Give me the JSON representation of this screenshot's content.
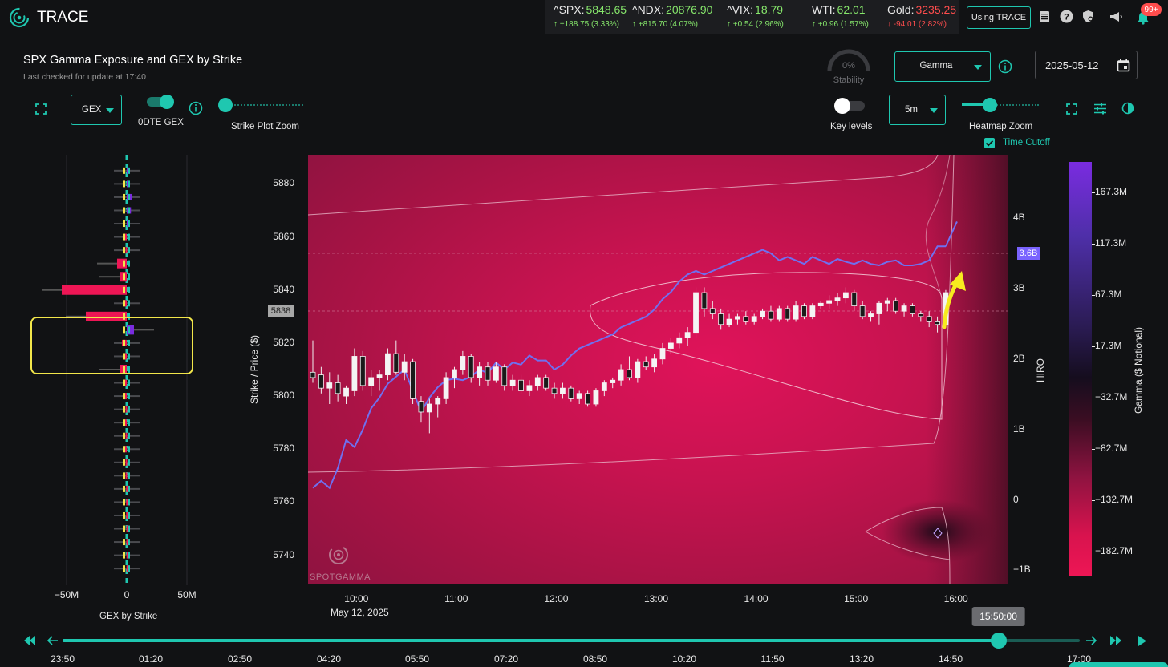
{
  "app": {
    "title": "TRACE"
  },
  "tickers": [
    {
      "label": "^SPX:",
      "value": "5848.65",
      "change": "↑ +188.75 (3.33%)",
      "dir": "up"
    },
    {
      "label": "^NDX:",
      "value": "20876.90",
      "change": "↑ +815.70 (4.07%)",
      "dir": "up"
    },
    {
      "label": "^VIX:",
      "value": "18.79",
      "change": "↑ +0.54 (2.96%)",
      "dir": "up"
    },
    {
      "label": "WTI:",
      "value": "62.01",
      "change": "↑ +0.96 (1.57%)",
      "dir": "up"
    },
    {
      "label": "Gold:",
      "value": "3235.25",
      "change": "↓ -94.01 (2.82%)",
      "dir": "down"
    }
  ],
  "header": {
    "using_trace": "Using TRACE",
    "notification_count": "99+"
  },
  "panel": {
    "title": "SPX Gamma Exposure and GEX by Strike",
    "subtitle": "Last checked for update at 17:40"
  },
  "controls": {
    "gex_select": "GEX",
    "zero_dte_label": "0DTE GEX",
    "strike_zoom_label": "Strike Plot Zoom",
    "stability_value": "0%",
    "stability_label": "Stability",
    "metric_select": "Gamma",
    "date_value": "2025-05-12",
    "key_levels_label": "Key levels",
    "interval_select": "5m",
    "heatmap_zoom_label": "Heatmap Zoom",
    "time_cutoff_label": "Time Cutoff"
  },
  "strike_chart": {
    "xlabel": "GEX by Strike",
    "xticks": [
      "−50M",
      "0",
      "50M"
    ]
  },
  "main_chart": {
    "ylabel": "Strike / Price ($)",
    "yticks": [
      "5880",
      "5860",
      "5840",
      "5820",
      "5800",
      "5780",
      "5760",
      "5740"
    ],
    "price_marker": "5838",
    "xticks": [
      "10:00",
      "11:00",
      "12:00",
      "13:00",
      "14:00",
      "15:00",
      "16:00"
    ],
    "date_label": "May 12, 2025",
    "hiro_label": "HIRO",
    "hiro_ticks": [
      "4B",
      "3B",
      "2B",
      "1B",
      "0",
      "−1B"
    ],
    "hiro_marker": "3.6B",
    "watermark": "SPOTGAMMA"
  },
  "colorbar": {
    "label": "Gamma ($ Notional)",
    "ticks": [
      "167.3M",
      "117.3M",
      "67.3M",
      "17.3M",
      "−32.7M",
      "−82.7M",
      "−132.7M",
      "−182.7M"
    ]
  },
  "timeline": {
    "current_time": "15:50:00",
    "position": 0.92,
    "ticks": [
      "23:50",
      "01:20",
      "02:50",
      "04:20",
      "05:50",
      "07:20",
      "08:50",
      "10:20",
      "11:50",
      "13:20",
      "14:50",
      "17:00"
    ]
  },
  "chart_data": {
    "type": "candlestick",
    "title": "SPX Gamma Exposure and GEX by Strike",
    "xlabel": "",
    "ylabel": "Strike / Price ($)",
    "ylim": [
      5729,
      5891
    ],
    "xlim_time": [
      "09:30",
      "16:30"
    ],
    "hiro_ylim": [
      "−1.2B",
      "4.9B"
    ],
    "candles": [
      {
        "t": "09:30",
        "o": 5809,
        "h": 5821,
        "l": 5805,
        "c": 5807
      },
      {
        "t": "09:35",
        "o": 5808,
        "h": 5811,
        "l": 5801,
        "c": 5803
      },
      {
        "t": "09:40",
        "o": 5803,
        "h": 5809,
        "l": 5797,
        "c": 5805
      },
      {
        "t": "09:45",
        "o": 5805,
        "h": 5808,
        "l": 5798,
        "c": 5801
      },
      {
        "t": "09:50",
        "o": 5800,
        "h": 5804,
        "l": 5797,
        "c": 5803
      },
      {
        "t": "09:55",
        "o": 5802,
        "h": 5818,
        "l": 5800,
        "c": 5815
      },
      {
        "t": "10:00",
        "o": 5815,
        "h": 5817,
        "l": 5802,
        "c": 5804
      },
      {
        "t": "10:05",
        "o": 5804,
        "h": 5810,
        "l": 5800,
        "c": 5807
      },
      {
        "t": "10:10",
        "o": 5807,
        "h": 5810,
        "l": 5802,
        "c": 5808
      },
      {
        "t": "10:15",
        "o": 5808,
        "h": 5818,
        "l": 5806,
        "c": 5816
      },
      {
        "t": "10:20",
        "o": 5816,
        "h": 5821,
        "l": 5808,
        "c": 5809
      },
      {
        "t": "10:25",
        "o": 5809,
        "h": 5816,
        "l": 5806,
        "c": 5813
      },
      {
        "t": "10:30",
        "o": 5813,
        "h": 5814,
        "l": 5797,
        "c": 5799
      },
      {
        "t": "10:35",
        "o": 5798,
        "h": 5800,
        "l": 5790,
        "c": 5794
      },
      {
        "t": "10:40",
        "o": 5794,
        "h": 5799,
        "l": 5786,
        "c": 5797
      },
      {
        "t": "10:45",
        "o": 5797,
        "h": 5800,
        "l": 5792,
        "c": 5799
      },
      {
        "t": "10:50",
        "o": 5799,
        "h": 5809,
        "l": 5797,
        "c": 5807
      },
      {
        "t": "10:55",
        "o": 5807,
        "h": 5811,
        "l": 5803,
        "c": 5810
      },
      {
        "t": "11:00",
        "o": 5810,
        "h": 5817,
        "l": 5808,
        "c": 5815
      },
      {
        "t": "11:05",
        "o": 5815,
        "h": 5816,
        "l": 5805,
        "c": 5807
      },
      {
        "t": "11:10",
        "o": 5807,
        "h": 5813,
        "l": 5804,
        "c": 5811
      },
      {
        "t": "11:15",
        "o": 5811,
        "h": 5813,
        "l": 5804,
        "c": 5806
      },
      {
        "t": "11:20",
        "o": 5806,
        "h": 5813,
        "l": 5805,
        "c": 5811
      },
      {
        "t": "11:25",
        "o": 5811,
        "h": 5812,
        "l": 5802,
        "c": 5804
      },
      {
        "t": "11:30",
        "o": 5804,
        "h": 5808,
        "l": 5802,
        "c": 5806
      },
      {
        "t": "11:35",
        "o": 5806,
        "h": 5808,
        "l": 5801,
        "c": 5802
      },
      {
        "t": "11:40",
        "o": 5802,
        "h": 5806,
        "l": 5800,
        "c": 5804
      },
      {
        "t": "11:45",
        "o": 5804,
        "h": 5808,
        "l": 5802,
        "c": 5807
      },
      {
        "t": "11:50",
        "o": 5807,
        "h": 5808,
        "l": 5802,
        "c": 5803
      },
      {
        "t": "11:55",
        "o": 5803,
        "h": 5805,
        "l": 5799,
        "c": 5801
      },
      {
        "t": "12:00",
        "o": 5801,
        "h": 5805,
        "l": 5799,
        "c": 5803
      },
      {
        "t": "12:05",
        "o": 5803,
        "h": 5804,
        "l": 5798,
        "c": 5799
      },
      {
        "t": "12:10",
        "o": 5799,
        "h": 5802,
        "l": 5797,
        "c": 5801
      },
      {
        "t": "12:15",
        "o": 5801,
        "h": 5802,
        "l": 5796,
        "c": 5797
      },
      {
        "t": "12:20",
        "o": 5797,
        "h": 5803,
        "l": 5796,
        "c": 5802
      },
      {
        "t": "12:25",
        "o": 5802,
        "h": 5806,
        "l": 5800,
        "c": 5805
      },
      {
        "t": "12:30",
        "o": 5805,
        "h": 5807,
        "l": 5803,
        "c": 5806
      },
      {
        "t": "12:35",
        "o": 5806,
        "h": 5812,
        "l": 5804,
        "c": 5810
      },
      {
        "t": "12:40",
        "o": 5810,
        "h": 5815,
        "l": 5806,
        "c": 5807
      },
      {
        "t": "12:45",
        "o": 5807,
        "h": 5814,
        "l": 5805,
        "c": 5813
      },
      {
        "t": "12:50",
        "o": 5813,
        "h": 5815,
        "l": 5810,
        "c": 5811
      },
      {
        "t": "12:55",
        "o": 5811,
        "h": 5816,
        "l": 5809,
        "c": 5814
      },
      {
        "t": "13:00",
        "o": 5814,
        "h": 5820,
        "l": 5812,
        "c": 5818
      },
      {
        "t": "13:05",
        "o": 5818,
        "h": 5822,
        "l": 5816,
        "c": 5820
      },
      {
        "t": "13:10",
        "o": 5820,
        "h": 5824,
        "l": 5818,
        "c": 5822
      },
      {
        "t": "13:15",
        "o": 5822,
        "h": 5826,
        "l": 5819,
        "c": 5824
      },
      {
        "t": "13:20",
        "o": 5824,
        "h": 5841,
        "l": 5822,
        "c": 5839
      },
      {
        "t": "13:25",
        "o": 5839,
        "h": 5841,
        "l": 5830,
        "c": 5833
      },
      {
        "t": "13:30",
        "o": 5833,
        "h": 5836,
        "l": 5829,
        "c": 5831
      },
      {
        "t": "13:35",
        "o": 5831,
        "h": 5833,
        "l": 5825,
        "c": 5827
      },
      {
        "t": "13:40",
        "o": 5827,
        "h": 5831,
        "l": 5826,
        "c": 5829
      },
      {
        "t": "13:45",
        "o": 5829,
        "h": 5831,
        "l": 5827,
        "c": 5830
      },
      {
        "t": "13:50",
        "o": 5830,
        "h": 5832,
        "l": 5827,
        "c": 5828
      },
      {
        "t": "13:55",
        "o": 5828,
        "h": 5831,
        "l": 5827,
        "c": 5830
      },
      {
        "t": "14:00",
        "o": 5830,
        "h": 5833,
        "l": 5829,
        "c": 5832
      },
      {
        "t": "14:05",
        "o": 5832,
        "h": 5834,
        "l": 5828,
        "c": 5829
      },
      {
        "t": "14:10",
        "o": 5829,
        "h": 5834,
        "l": 5828,
        "c": 5833
      },
      {
        "t": "14:15",
        "o": 5833,
        "h": 5834,
        "l": 5828,
        "c": 5829
      },
      {
        "t": "14:20",
        "o": 5829,
        "h": 5836,
        "l": 5828,
        "c": 5834
      },
      {
        "t": "14:25",
        "o": 5834,
        "h": 5835,
        "l": 5829,
        "c": 5830
      },
      {
        "t": "14:30",
        "o": 5830,
        "h": 5835,
        "l": 5829,
        "c": 5834
      },
      {
        "t": "14:35",
        "o": 5834,
        "h": 5836,
        "l": 5833,
        "c": 5835
      },
      {
        "t": "14:40",
        "o": 5835,
        "h": 5838,
        "l": 5833,
        "c": 5836
      },
      {
        "t": "14:45",
        "o": 5836,
        "h": 5839,
        "l": 5834,
        "c": 5837
      },
      {
        "t": "14:50",
        "o": 5837,
        "h": 5841,
        "l": 5835,
        "c": 5839
      },
      {
        "t": "14:55",
        "o": 5839,
        "h": 5840,
        "l": 5832,
        "c": 5834
      },
      {
        "t": "15:00",
        "o": 5834,
        "h": 5836,
        "l": 5829,
        "c": 5830
      },
      {
        "t": "15:05",
        "o": 5830,
        "h": 5832,
        "l": 5828,
        "c": 5831
      },
      {
        "t": "15:10",
        "o": 5831,
        "h": 5836,
        "l": 5827,
        "c": 5835
      },
      {
        "t": "15:15",
        "o": 5835,
        "h": 5837,
        "l": 5832,
        "c": 5836
      },
      {
        "t": "15:20",
        "o": 5836,
        "h": 5837,
        "l": 5831,
        "c": 5832
      },
      {
        "t": "15:25",
        "o": 5832,
        "h": 5835,
        "l": 5830,
        "c": 5834
      },
      {
        "t": "15:30",
        "o": 5834,
        "h": 5835,
        "l": 5830,
        "c": 5831
      },
      {
        "t": "15:35",
        "o": 5831,
        "h": 5832,
        "l": 5828,
        "c": 5830
      },
      {
        "t": "15:40",
        "o": 5830,
        "h": 5832,
        "l": 5826,
        "c": 5828
      },
      {
        "t": "15:45",
        "o": 5828,
        "h": 5830,
        "l": 5824,
        "c": 5827
      },
      {
        "t": "15:50",
        "o": 5827,
        "h": 5840,
        "l": 5826,
        "c": 5839
      }
    ],
    "hiro": [
      {
        "t": "09:30",
        "v": 0.17
      },
      {
        "t": "09:35",
        "v": 0.27
      },
      {
        "t": "09:40",
        "v": 0.17
      },
      {
        "t": "09:45",
        "v": 0.45
      },
      {
        "t": "09:50",
        "v": 0.85
      },
      {
        "t": "09:55",
        "v": 0.75
      },
      {
        "t": "10:00",
        "v": 1.0
      },
      {
        "t": "10:05",
        "v": 1.3
      },
      {
        "t": "10:10",
        "v": 1.45
      },
      {
        "t": "10:15",
        "v": 1.65
      },
      {
        "t": "10:20",
        "v": 1.75
      },
      {
        "t": "10:25",
        "v": 1.85
      },
      {
        "t": "10:30",
        "v": 1.55
      },
      {
        "t": "10:35",
        "v": 1.25
      },
      {
        "t": "10:40",
        "v": 1.45
      },
      {
        "t": "10:45",
        "v": 1.6
      },
      {
        "t": "10:50",
        "v": 1.7
      },
      {
        "t": "10:55",
        "v": 1.72
      },
      {
        "t": "11:00",
        "v": 1.7
      },
      {
        "t": "11:05",
        "v": 1.75
      },
      {
        "t": "11:10",
        "v": 1.85
      },
      {
        "t": "11:15",
        "v": 1.8
      },
      {
        "t": "11:20",
        "v": 1.95
      },
      {
        "t": "11:25",
        "v": 1.85
      },
      {
        "t": "11:30",
        "v": 1.95
      },
      {
        "t": "11:35",
        "v": 1.92
      },
      {
        "t": "11:40",
        "v": 2.05
      },
      {
        "t": "11:45",
        "v": 1.98
      },
      {
        "t": "11:50",
        "v": 1.98
      },
      {
        "t": "11:55",
        "v": 1.85
      },
      {
        "t": "12:00",
        "v": 1.92
      },
      {
        "t": "12:05",
        "v": 2.05
      },
      {
        "t": "12:10",
        "v": 2.15
      },
      {
        "t": "12:15",
        "v": 2.2
      },
      {
        "t": "12:20",
        "v": 2.25
      },
      {
        "t": "12:25",
        "v": 2.3
      },
      {
        "t": "12:30",
        "v": 2.35
      },
      {
        "t": "12:35",
        "v": 2.45
      },
      {
        "t": "12:40",
        "v": 2.5
      },
      {
        "t": "12:45",
        "v": 2.55
      },
      {
        "t": "12:50",
        "v": 2.6
      },
      {
        "t": "12:55",
        "v": 2.7
      },
      {
        "t": "13:00",
        "v": 2.85
      },
      {
        "t": "13:05",
        "v": 2.95
      },
      {
        "t": "13:10",
        "v": 3.1
      },
      {
        "t": "13:15",
        "v": 3.2
      },
      {
        "t": "13:20",
        "v": 3.25
      },
      {
        "t": "13:25",
        "v": 3.2
      },
      {
        "t": "13:30",
        "v": 3.25
      },
      {
        "t": "13:35",
        "v": 3.3
      },
      {
        "t": "13:40",
        "v": 3.35
      },
      {
        "t": "13:45",
        "v": 3.4
      },
      {
        "t": "13:50",
        "v": 3.45
      },
      {
        "t": "13:55",
        "v": 3.5
      },
      {
        "t": "14:00",
        "v": 3.55
      },
      {
        "t": "14:05",
        "v": 3.5
      },
      {
        "t": "14:10",
        "v": 3.4
      },
      {
        "t": "14:15",
        "v": 3.45
      },
      {
        "t": "14:20",
        "v": 3.4
      },
      {
        "t": "14:25",
        "v": 3.35
      },
      {
        "t": "14:30",
        "v": 3.45
      },
      {
        "t": "14:35",
        "v": 3.4
      },
      {
        "t": "14:40",
        "v": 3.35
      },
      {
        "t": "14:45",
        "v": 3.42
      },
      {
        "t": "14:50",
        "v": 3.38
      },
      {
        "t": "14:55",
        "v": 3.35
      },
      {
        "t": "15:00",
        "v": 3.4
      },
      {
        "t": "15:05",
        "v": 3.35
      },
      {
        "t": "15:10",
        "v": 3.33
      },
      {
        "t": "15:15",
        "v": 3.38
      },
      {
        "t": "15:20",
        "v": 3.4
      },
      {
        "t": "15:25",
        "v": 3.33
      },
      {
        "t": "15:30",
        "v": 3.33
      },
      {
        "t": "15:35",
        "v": 3.35
      },
      {
        "t": "15:40",
        "v": 3.4
      },
      {
        "t": "15:45",
        "v": 3.6
      },
      {
        "t": "15:50",
        "v": 3.6
      }
    ],
    "gex_by_strike": [
      {
        "strike": 5885,
        "v": 0.5
      },
      {
        "strike": 5880,
        "v": 0.8
      },
      {
        "strike": 5875,
        "v": 4.5
      },
      {
        "strike": 5870,
        "v": 3.5
      },
      {
        "strike": 5865,
        "v": 2
      },
      {
        "strike": 5860,
        "v": -2.5
      },
      {
        "strike": 5855,
        "v": -1
      },
      {
        "strike": 5850,
        "v": -8
      },
      {
        "strike": 5845,
        "v": -6
      },
      {
        "strike": 5840,
        "v": -54
      },
      {
        "strike": 5835,
        "v": -3
      },
      {
        "strike": 5830,
        "v": -34
      },
      {
        "strike": 5825,
        "v": 6
      },
      {
        "strike": 5820,
        "v": -4
      },
      {
        "strike": 5815,
        "v": -2
      },
      {
        "strike": 5810,
        "v": -6
      },
      {
        "strike": 5805,
        "v": -3
      },
      {
        "strike": 5800,
        "v": -2
      },
      {
        "strike": 5795,
        "v": -1
      },
      {
        "strike": 5790,
        "v": -1.5
      },
      {
        "strike": 5785,
        "v": -1
      },
      {
        "strike": 5780,
        "v": -2
      },
      {
        "strike": 5775,
        "v": -1
      },
      {
        "strike": 5770,
        "v": -1
      },
      {
        "strike": 5765,
        "v": -0.5
      },
      {
        "strike": 5760,
        "v": -0.5
      },
      {
        "strike": 5755,
        "v": -0.5
      },
      {
        "strike": 5750,
        "v": -0.3
      },
      {
        "strike": 5745,
        "v": -0.3
      },
      {
        "strike": 5740,
        "v": -0.2
      },
      {
        "strike": 5735,
        "v": -0.2
      }
    ]
  }
}
